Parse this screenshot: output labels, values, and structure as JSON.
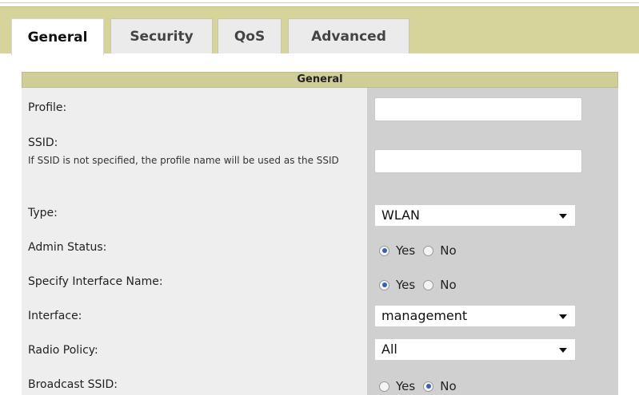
{
  "tabs": [
    {
      "label": "General",
      "active": true
    },
    {
      "label": "Security",
      "active": false
    },
    {
      "label": "QoS",
      "active": false
    },
    {
      "label": "Advanced",
      "active": false
    }
  ],
  "panel": {
    "title": "General",
    "fields": {
      "profile": {
        "label": "Profile:",
        "value": ""
      },
      "ssid": {
        "label": "SSID:",
        "hint": "If SSID is not specified, the profile name will be used as the SSID",
        "value": ""
      },
      "type": {
        "label": "Type:",
        "selected": "WLAN"
      },
      "admin_status": {
        "label": "Admin Status:",
        "options": [
          "Yes",
          "No"
        ],
        "selected": "Yes"
      },
      "specify_interface_name": {
        "label": "Specify Interface Name:",
        "options": [
          "Yes",
          "No"
        ],
        "selected": "Yes"
      },
      "interface": {
        "label": "Interface:",
        "selected": "management"
      },
      "radio_policy": {
        "label": "Radio Policy:",
        "selected": "All"
      },
      "broadcast_ssid": {
        "label": "Broadcast SSID:",
        "options": [
          "Yes",
          "No"
        ],
        "selected": "No"
      }
    }
  },
  "colors": {
    "tabbar_bg": "#d6d49a",
    "header_bg": "#cfce98",
    "label_col_bg": "#eeeeee",
    "value_col_bg": "#d0d0d0",
    "radio_accent": "#3a5fb0"
  }
}
